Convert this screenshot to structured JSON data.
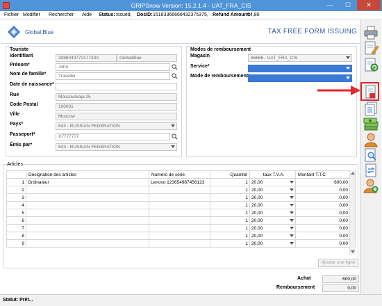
{
  "window": {
    "title": "GRIPSnow Version: 15.2.1.4 - UAT_FRA_CIS",
    "minimize": "—",
    "maximize": "☐",
    "close": "✕"
  },
  "menu": {
    "items": [
      {
        "label": "Fichier"
      },
      {
        "label": "Modifier"
      },
      {
        "label": "Rechercher"
      },
      {
        "label": "Aide"
      }
    ],
    "status_label": "Status:",
    "status_value": "Issued,",
    "docid_label": "DocID:",
    "docid_value": "15183366666432375375,",
    "refund_label": "Refund Amount:",
    "refund_value": "64,80"
  },
  "header": {
    "logo_text": "Global Blue",
    "title": "TAX FREE FORM ISSUING"
  },
  "tourist": {
    "group_title": "Touriste",
    "identifiant_label": "Identifiant",
    "identifiant_value": "3086040772177330",
    "identifiant_source": "GlobalBlue",
    "prenom_label": "Prénom*",
    "prenom_value": "John",
    "nom_label": "Nom de famille*",
    "nom_value": "Traveller",
    "dob_label": "Date de naissance*",
    "dob_value": "",
    "rue_label": "Rue",
    "rue_value": "Moscovskaja 25",
    "cp_label": "Code Postal",
    "cp_value": "100001",
    "ville_label": "Ville",
    "ville_value": "Moscow",
    "pays_label": "Pays*",
    "pays_value": "643 - RUSSIAN FEDERATION",
    "passeport_label": "Passeport*",
    "passeport_value": "X7777777",
    "emis_label": "Émis par*",
    "emis_value": "643 - RUSSIAN FEDERATION"
  },
  "refund": {
    "group_title": "Modes de remboursement",
    "magasin_label": "Magasin",
    "magasin_value": "66666 - UAT_FRA_CIS",
    "service_label": "Service*",
    "mode_label": "Mode de remboursement*"
  },
  "articles": {
    "group_title": "Articles",
    "columns": [
      "",
      "Désignation des articles",
      "Numéro de série",
      "Quantité",
      "taux T.V.A.",
      "Montant T.T.C"
    ],
    "rows": [
      {
        "n": "1",
        "designation": "Ordinateur",
        "serie": "Lenovo 123654987456123",
        "qty": "1",
        "tva": "20,00",
        "montant": "600,00"
      },
      {
        "n": "2",
        "designation": "",
        "serie": "",
        "qty": "1",
        "tva": "20,00",
        "montant": "0,00"
      },
      {
        "n": "3",
        "designation": "",
        "serie": "",
        "qty": "1",
        "tva": "20,00",
        "montant": "0,00"
      },
      {
        "n": "4",
        "designation": "",
        "serie": "",
        "qty": "1",
        "tva": "20,00",
        "montant": "0,00"
      },
      {
        "n": "5",
        "designation": "",
        "serie": "",
        "qty": "1",
        "tva": "20,00",
        "montant": "0,00"
      },
      {
        "n": "6",
        "designation": "",
        "serie": "",
        "qty": "1",
        "tva": "20,00",
        "montant": "0,00"
      },
      {
        "n": "7",
        "designation": "",
        "serie": "",
        "qty": "1",
        "tva": "20,00",
        "montant": "0,00"
      },
      {
        "n": "8",
        "designation": "",
        "serie": "",
        "qty": "1",
        "tva": "20,00",
        "montant": "0,00"
      },
      {
        "n": "9",
        "designation": "",
        "serie": "",
        "qty": "1",
        "tva": "20,00",
        "montant": "0,00"
      }
    ],
    "add_line_label": "Ajouter une ligne"
  },
  "totals": {
    "achat_label": "Achat",
    "achat_value": "600,00",
    "remboursement_label": "Remboursement",
    "remboursement_value": "0,00"
  },
  "status": {
    "text": "Statut: Prêt..."
  },
  "toolbar": {
    "icons": [
      "printer-icon",
      "edit-form-icon",
      "refresh-form-icon",
      "issue-form-icon",
      "documents-list-icon",
      "money-stack-icon",
      "user-icon",
      "search-document-icon",
      "transfer-document-icon",
      "user-add-icon"
    ]
  },
  "colors": {
    "titlebar": "#4f93d8",
    "accent_blue": "#2a5b9a",
    "highlight": "#e5252a"
  }
}
